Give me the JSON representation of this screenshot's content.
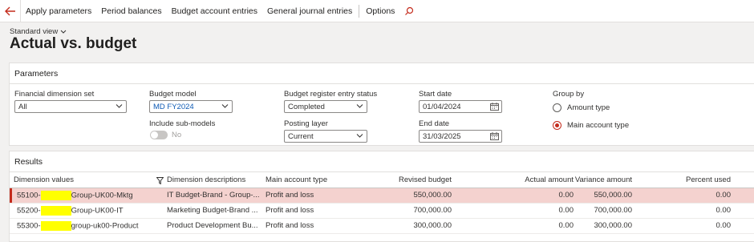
{
  "toolbar": {
    "items": [
      "Apply parameters",
      "Period balances",
      "Budget account entries",
      "General journal entries",
      "Options"
    ]
  },
  "header": {
    "view": "Standard view",
    "title": "Actual vs. budget"
  },
  "parameters": {
    "title": "Parameters",
    "financial_dimension_set": {
      "label": "Financial dimension set",
      "value": "All"
    },
    "budget_model": {
      "label": "Budget model",
      "value": "MD FY2024"
    },
    "include_sub_models": {
      "label": "Include sub-models",
      "value": "No"
    },
    "entry_status": {
      "label": "Budget register entry status",
      "value": "Completed"
    },
    "posting_layer": {
      "label": "Posting layer",
      "value": "Current"
    },
    "start_date": {
      "label": "Start date",
      "value": "01/04/2024"
    },
    "end_date": {
      "label": "End date",
      "value": "31/03/2025"
    },
    "group_by": {
      "label": "Group by",
      "options": [
        "Amount type",
        "Main account type"
      ],
      "selected": "Main account type"
    }
  },
  "results": {
    "title": "Results",
    "columns": [
      "Dimension values",
      "Dimension descriptions",
      "Main account type",
      "Revised budget",
      "Actual amount",
      "Variance amount",
      "Percent used"
    ],
    "rows": [
      {
        "dim_prefix": "55100-",
        "dim_suffix": "Group-UK00-Mktg",
        "desc": "IT Budget-Brand - Group-...",
        "type": "Profit and loss",
        "revised": "550,000.00",
        "actual": "0.00",
        "variance": "550,000.00",
        "percent": "0.00"
      },
      {
        "dim_prefix": "55200-",
        "dim_suffix": "Group-UK00-IT",
        "desc": "Marketing Budget-Brand ...",
        "type": "Profit and loss",
        "revised": "700,000.00",
        "actual": "0.00",
        "variance": "700,000.00",
        "percent": "0.00"
      },
      {
        "dim_prefix": "55300-",
        "dim_suffix": "group-uk00-Product",
        "desc": "Product Development Bu...",
        "type": "Profit and loss",
        "revised": "300,000.00",
        "actual": "0.00",
        "variance": "300,000.00",
        "percent": "0.00"
      }
    ]
  },
  "colors": {
    "accent": "#c42b1c",
    "selected_row": "#f4d2cf",
    "redaction": "#ffff00",
    "link_blue": "#0f5bb5"
  }
}
